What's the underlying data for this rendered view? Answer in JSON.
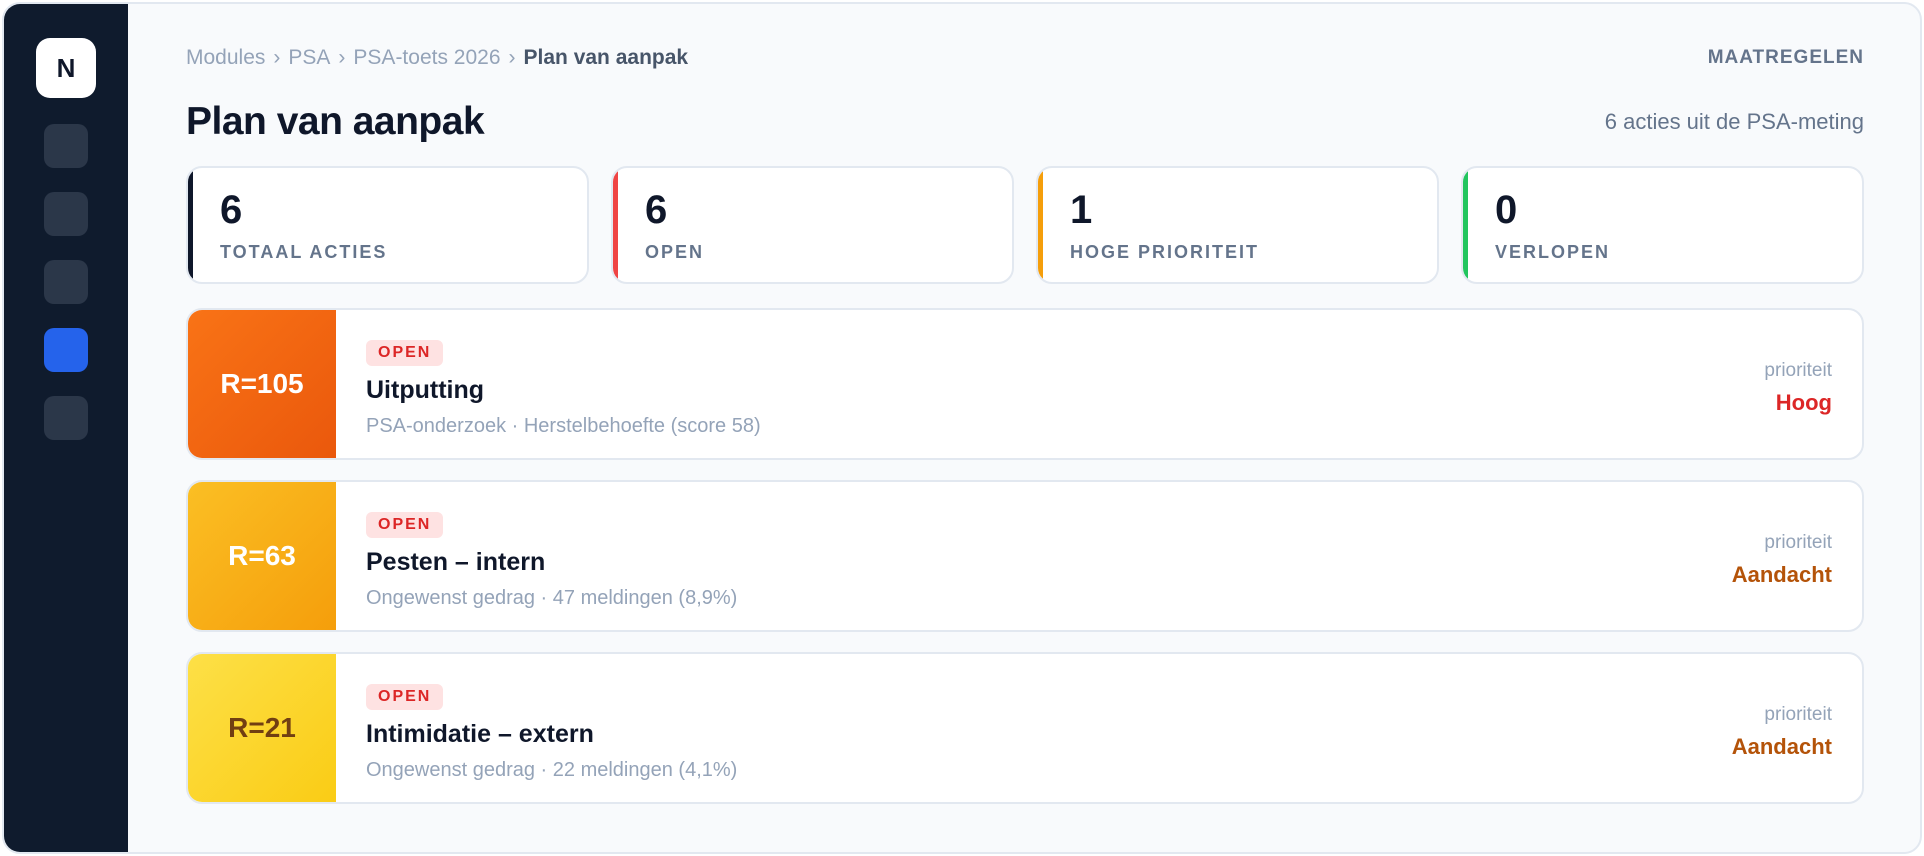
{
  "sidebar": {
    "logo": "N",
    "items": [
      {
        "name": "nav-item-1",
        "active": false
      },
      {
        "name": "nav-item-2",
        "active": false
      },
      {
        "name": "nav-item-3",
        "active": false
      },
      {
        "name": "nav-item-4",
        "active": true
      },
      {
        "name": "nav-item-5",
        "active": false
      }
    ]
  },
  "header": {
    "breadcrumb": [
      "Modules",
      "PSA",
      "PSA-toets 2026",
      "Plan van aanpak"
    ],
    "breadcrumb_separator": "›",
    "module_tag": "MAATREGELEN",
    "title": "Plan van aanpak",
    "subtitle": "6 acties uit de PSA-meting"
  },
  "stats": [
    {
      "value": "6",
      "label": "TOTAAL ACTIES",
      "color": "#0f172a"
    },
    {
      "value": "6",
      "label": "OPEN",
      "color": "#ef4444"
    },
    {
      "value": "1",
      "label": "HOGE PRIORITEIT",
      "color": "#f59e0b"
    },
    {
      "value": "0",
      "label": "VERLOPEN",
      "color": "#22c55e"
    }
  ],
  "actions": [
    {
      "risk": "R=105",
      "risk_gradient": [
        "#f97316",
        "#ea580c"
      ],
      "risk_text_color": "#ffffff",
      "status": "OPEN",
      "title": "Uitputting",
      "meta": "PSA-onderzoek · Herstelbehoefte (score 58)",
      "priority_label": "prioriteit",
      "priority": "Hoog",
      "priority_color": "#dc2626"
    },
    {
      "risk": "R=63",
      "risk_gradient": [
        "#fbbf24",
        "#f59e0b"
      ],
      "risk_text_color": "#ffffff",
      "status": "OPEN",
      "title": "Pesten – intern",
      "meta": "Ongewenst gedrag · 47 meldingen (8,9%)",
      "priority_label": "prioriteit",
      "priority": "Aandacht",
      "priority_color": "#b45309"
    },
    {
      "risk": "R=21",
      "risk_gradient": [
        "#fde047",
        "#facc15"
      ],
      "risk_text_color": "#713f12",
      "status": "OPEN",
      "title": "Intimidatie – extern",
      "meta": "Ongewenst gedrag · 22 meldingen (4,1%)",
      "priority_label": "prioriteit",
      "priority": "Aandacht",
      "priority_color": "#b45309"
    }
  ]
}
